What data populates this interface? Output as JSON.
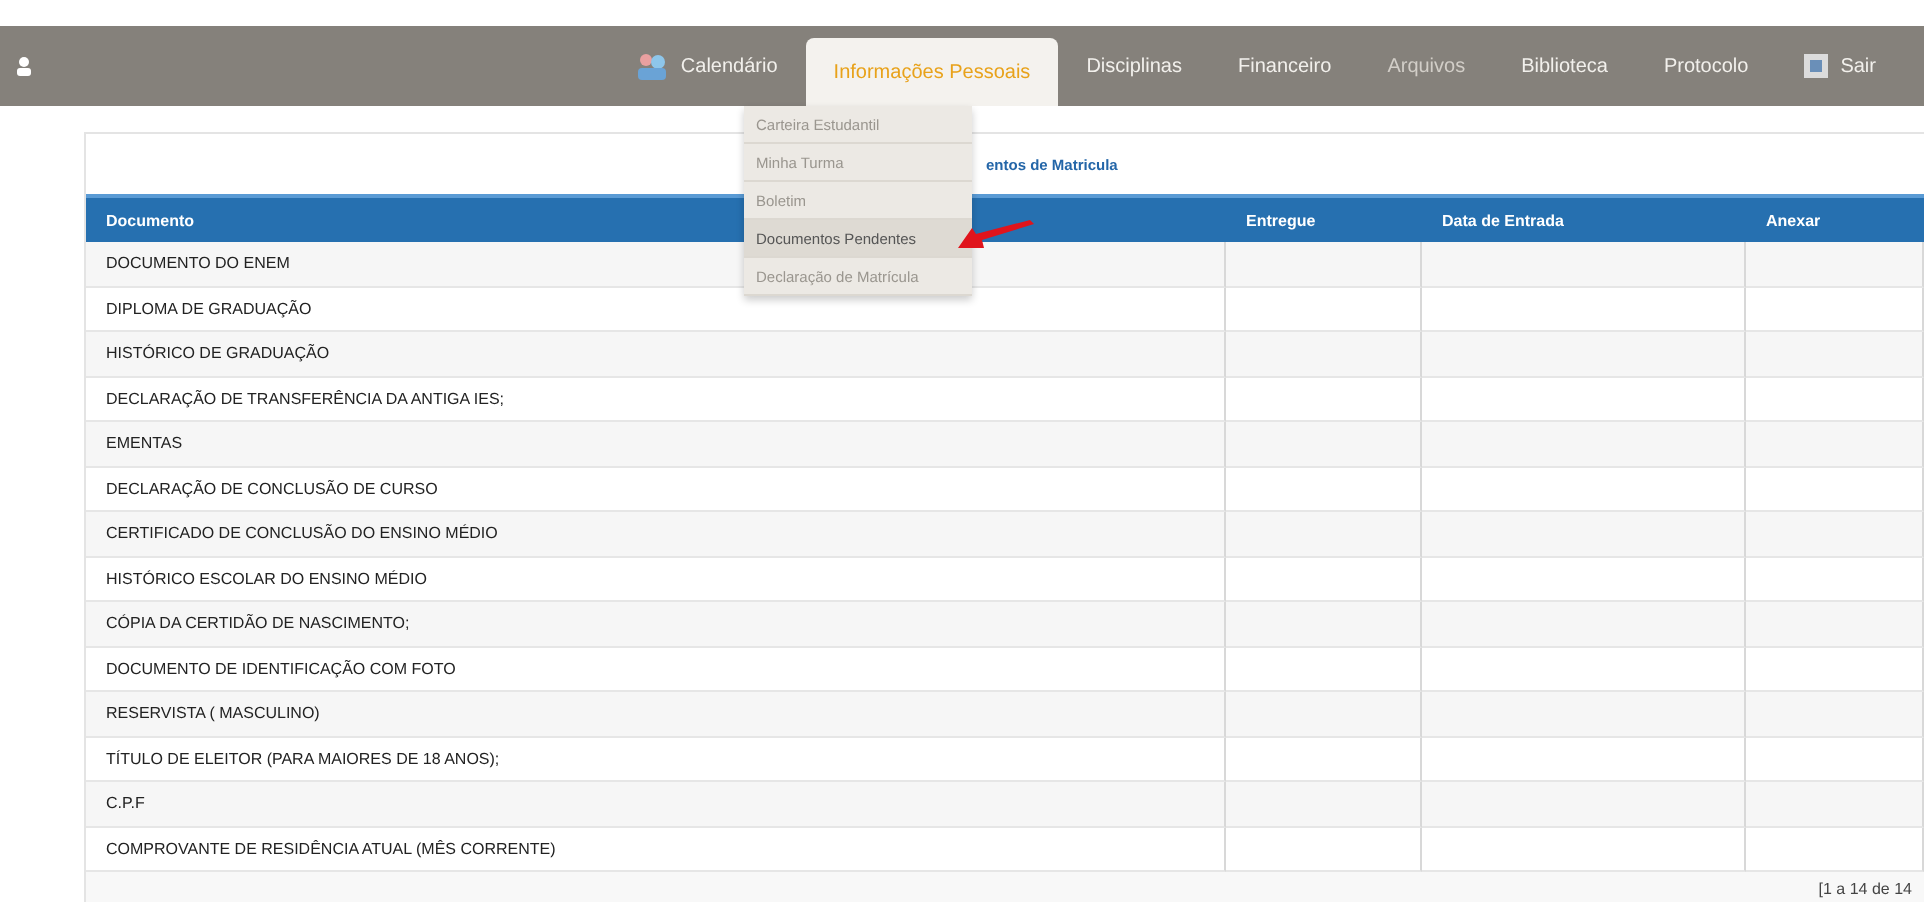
{
  "nav": {
    "items": [
      {
        "label": "Calendário",
        "kind": "icon",
        "selected": false,
        "disabled": false
      },
      {
        "label": "Informações Pessoais",
        "kind": "text",
        "selected": true,
        "disabled": false
      },
      {
        "label": "Disciplinas",
        "kind": "text",
        "selected": false,
        "disabled": false
      },
      {
        "label": "Financeiro",
        "kind": "text",
        "selected": false,
        "disabled": false
      },
      {
        "label": "Arquivos",
        "kind": "text",
        "selected": false,
        "disabled": true
      },
      {
        "label": "Biblioteca",
        "kind": "text",
        "selected": false,
        "disabled": false
      },
      {
        "label": "Protocolo",
        "kind": "text",
        "selected": false,
        "disabled": false
      },
      {
        "label": "Sair",
        "kind": "icon",
        "selected": false,
        "disabled": false
      }
    ]
  },
  "dropdown": {
    "items": [
      {
        "label": "Carteira Estudantil",
        "selected": false
      },
      {
        "label": "Minha Turma",
        "selected": false
      },
      {
        "label": "Boletim",
        "selected": false
      },
      {
        "label": "Documentos Pendentes",
        "selected": true
      },
      {
        "label": "Declaração de Matrícula",
        "selected": false
      }
    ]
  },
  "panel": {
    "title": "entos de Matricula"
  },
  "table": {
    "columns": [
      "Documento",
      "Entregue",
      "Data de Entrada",
      "Anexar"
    ],
    "rows": [
      "DOCUMENTO DO ENEM",
      "DIPLOMA DE GRADUAÇÃO",
      "HISTÓRICO DE GRADUAÇÃO",
      "DECLARAÇÃO DE TRANSFERÊNCIA DA ANTIGA IES;",
      "EMENTAS",
      "DECLARAÇÃO DE CONCLUSÃO DE CURSO",
      "CERTIFICADO DE CONCLUSÃO DO ENSINO MÉDIO",
      "HISTÓRICO ESCOLAR DO ENSINO MÉDIO",
      "CÓPIA DA CERTIDÃO DE NASCIMENTO;",
      "DOCUMENTO DE IDENTIFICAÇÃO COM FOTO",
      "RESERVISTA ( MASCULINO)",
      "TÍTULO DE ELEITOR (PARA MAIORES DE 18 ANOS);",
      "C.P.F",
      "COMPROVANTE DE RESIDÊNCIA ATUAL (MÊS CORRENTE)"
    ],
    "pager": "[1 a 14 de 14"
  }
}
